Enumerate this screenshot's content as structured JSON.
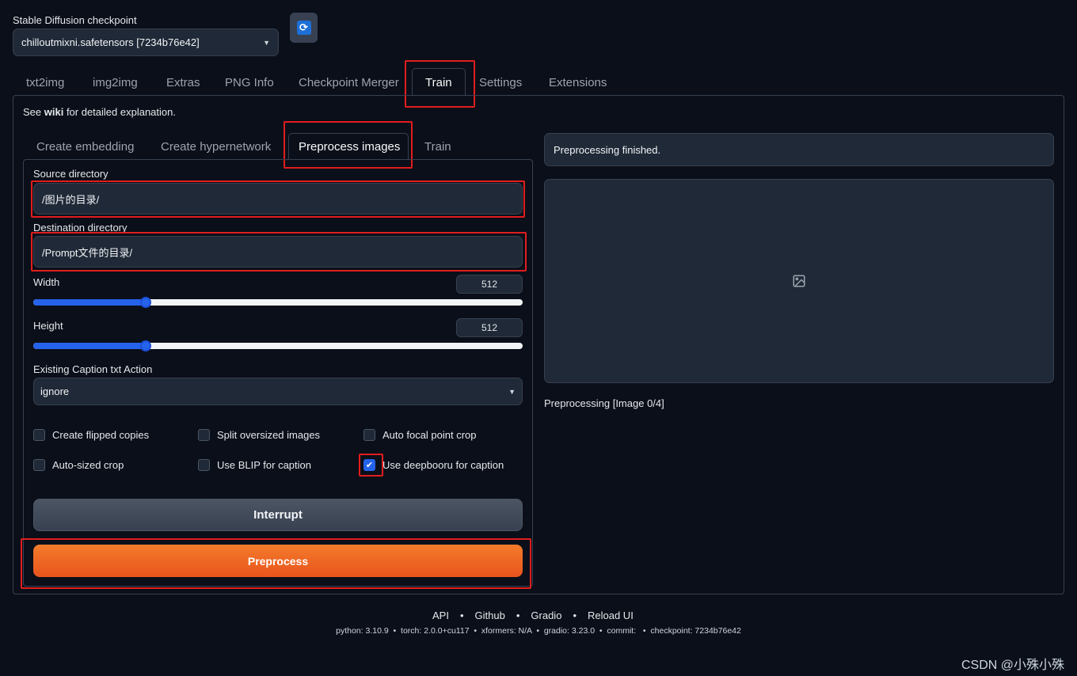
{
  "checkpoint": {
    "label": "Stable Diffusion checkpoint",
    "value": "chilloutmixni.safetensors [7234b76e42]"
  },
  "main_tabs": [
    {
      "label": "txt2img"
    },
    {
      "label": "img2img"
    },
    {
      "label": "Extras"
    },
    {
      "label": "PNG Info"
    },
    {
      "label": "Checkpoint Merger"
    },
    {
      "label": "Train"
    },
    {
      "label": "Settings"
    },
    {
      "label": "Extensions"
    }
  ],
  "wiki_note": {
    "prefix": "See ",
    "link": "wiki",
    "suffix": " for detailed explanation."
  },
  "sub_tabs": [
    {
      "label": "Create embedding"
    },
    {
      "label": "Create hypernetwork"
    },
    {
      "label": "Preprocess images"
    },
    {
      "label": "Train"
    }
  ],
  "form": {
    "source_label": "Source directory",
    "source_value": "/图片的目录/",
    "dest_label": "Destination directory",
    "dest_value": "/Prompt文件的目录/",
    "width_label": "Width",
    "width_value": "512",
    "width_fraction": 0.23,
    "height_label": "Height",
    "height_value": "512",
    "height_fraction": 0.23,
    "caption_action_label": "Existing Caption txt Action",
    "caption_action_value": "ignore",
    "checkboxes": [
      {
        "label": "Create flipped copies",
        "checked": false
      },
      {
        "label": "Split oversized images",
        "checked": false
      },
      {
        "label": "Auto focal point crop",
        "checked": false
      },
      {
        "label": "Auto-sized crop",
        "checked": false
      },
      {
        "label": "Use BLIP for caption",
        "checked": false
      },
      {
        "label": "Use deepbooru for caption",
        "checked": true
      }
    ],
    "interrupt_label": "Interrupt",
    "preprocess_label": "Preprocess"
  },
  "output": {
    "status": "Preprocessing finished.",
    "progress": "Preprocessing [Image 0/4]"
  },
  "footer": {
    "links": [
      "API",
      "Github",
      "Gradio",
      "Reload UI"
    ],
    "info": "python: 3.10.9  •  torch: 2.0.0+cu117  •  xformers: N/A  •  gradio: 3.23.0  •  commit:   •  checkpoint: 7234b76e42"
  },
  "watermark": "CSDN @小殊小殊",
  "colors": {
    "background": "#0b0f19",
    "panel": "#1f2937",
    "accent": "#2563eb",
    "preprocess_button": "#f26c22",
    "highlight_border": "#e11d1d"
  }
}
